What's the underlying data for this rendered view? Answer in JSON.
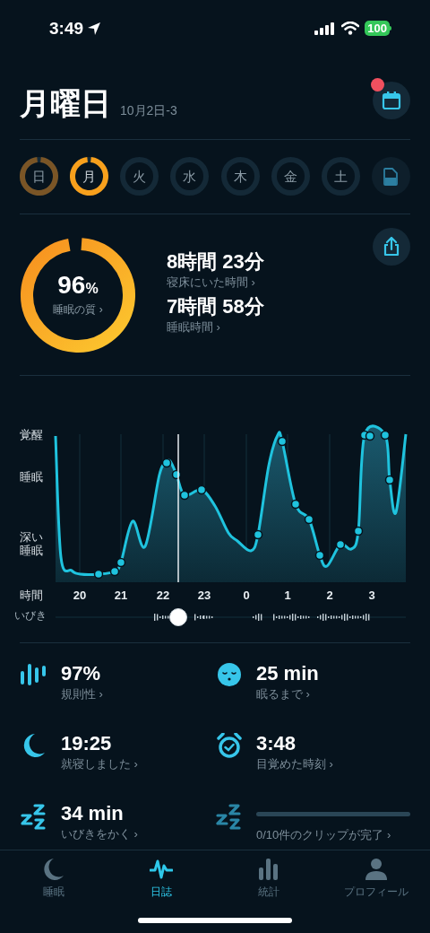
{
  "status_bar": {
    "time": "3:49",
    "battery": "100"
  },
  "header": {
    "title": "月曜日",
    "subtitle": "10月2日-3",
    "calendar_notification": true
  },
  "days": [
    {
      "label": "日",
      "recorded": true,
      "selected": false
    },
    {
      "label": "月",
      "recorded": true,
      "selected": true
    },
    {
      "label": "火",
      "recorded": false,
      "selected": false
    },
    {
      "label": "水",
      "recorded": false,
      "selected": false
    },
    {
      "label": "木",
      "recorded": false,
      "selected": false
    },
    {
      "label": "金",
      "recorded": false,
      "selected": false
    },
    {
      "label": "土",
      "recorded": false,
      "selected": false
    }
  ],
  "quality": {
    "value": "96",
    "unit": "%",
    "label": "睡眠の質 ›"
  },
  "durations": [
    {
      "value": "8時間 23分",
      "label": "寝床にいた時間 ›"
    },
    {
      "value": "7時間 58分",
      "label": "睡眠時間 ›"
    }
  ],
  "sleep_graph": {
    "stage_labels": [
      "覚醒",
      "睡眠",
      "深い睡眠"
    ],
    "hour_axis_label": "時間",
    "hours": [
      "20",
      "21",
      "22",
      "23",
      "0",
      "1",
      "2",
      "3"
    ],
    "snore_label": "いびき"
  },
  "stats": [
    {
      "kind": "regularity",
      "value": "97%",
      "label": "規則性 ›"
    },
    {
      "kind": "latency",
      "value": "25 min",
      "label": "眠るまで ›"
    },
    {
      "kind": "bedtime",
      "value": "19:25",
      "label": "就寝しました ›"
    },
    {
      "kind": "wake",
      "value": "3:48",
      "label": "目覚めた時刻 ›"
    },
    {
      "kind": "snoring",
      "value": "34 min",
      "label": "いびきをかく ›"
    },
    {
      "kind": "clips",
      "level": 0,
      "label": "0/10件のクリップが完了 ›"
    }
  ],
  "tabs": [
    {
      "kind": "sleep",
      "label": "睡眠",
      "selected": false
    },
    {
      "kind": "journal",
      "label": "日誌",
      "selected": true
    },
    {
      "kind": "stats",
      "label": "統計",
      "selected": false
    },
    {
      "kind": "profile",
      "label": "プロフィール",
      "selected": false
    }
  ]
}
